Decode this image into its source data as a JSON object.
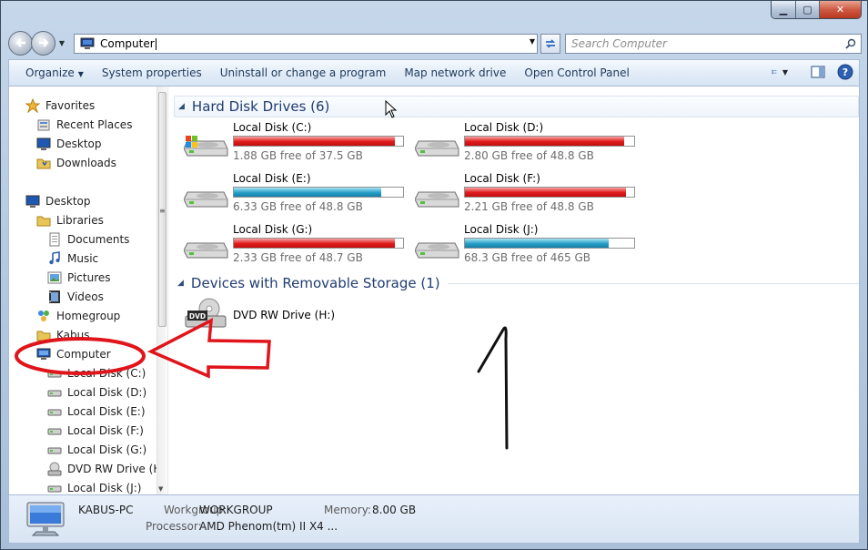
{
  "window": {
    "caption_min": "▁",
    "caption_max": "▢",
    "caption_close": "✕"
  },
  "address": {
    "value": "Computer"
  },
  "search": {
    "placeholder": "Search Computer"
  },
  "toolbar": {
    "organize": "Organize",
    "system_properties": "System properties",
    "uninstall": "Uninstall or change a program",
    "map_network_drive": "Map network drive",
    "open_control_panel": "Open Control Panel"
  },
  "navpane": {
    "items": [
      {
        "label": "Favorites",
        "icon": "star-icon"
      },
      {
        "label": "Recent Places",
        "icon": "recent-places-icon"
      },
      {
        "label": "Desktop",
        "icon": "desktop-icon"
      },
      {
        "label": "Downloads",
        "icon": "folder-icon"
      },
      {
        "label": "Desktop",
        "icon": "desktop-icon"
      },
      {
        "label": "Libraries",
        "icon": "libraries-icon"
      },
      {
        "label": "Documents",
        "icon": "documents-icon"
      },
      {
        "label": "Music",
        "icon": "music-icon"
      },
      {
        "label": "Pictures",
        "icon": "pictures-icon"
      },
      {
        "label": "Videos",
        "icon": "videos-icon"
      },
      {
        "label": "Homegroup",
        "icon": "homegroup-icon"
      },
      {
        "label": "Kabus",
        "icon": "user-folder-icon"
      },
      {
        "label": "Computer",
        "icon": "computer-icon"
      },
      {
        "label": "Local Disk (C:)",
        "icon": "drive-icon"
      },
      {
        "label": "Local Disk (D:)",
        "icon": "drive-icon"
      },
      {
        "label": "Local Disk (E:)",
        "icon": "drive-icon"
      },
      {
        "label": "Local Disk (F:)",
        "icon": "drive-icon"
      },
      {
        "label": "Local Disk (G:)",
        "icon": "drive-icon"
      },
      {
        "label": "DVD RW Drive (H:",
        "icon": "dvd-drive-icon"
      },
      {
        "label": "Local Disk (J:)",
        "icon": "drive-icon"
      }
    ]
  },
  "groups": {
    "hdd": "Hard Disk Drives (6)",
    "removable": "Devices with Removable Storage (1)"
  },
  "drives": [
    {
      "name": "Local Disk (C:)",
      "free": "1.88 GB free of 37.5 GB",
      "used_fraction": 0.95,
      "status": "red",
      "system": true
    },
    {
      "name": "Local Disk (D:)",
      "free": "2.80 GB free of 48.8 GB",
      "used_fraction": 0.94,
      "status": "red",
      "system": false
    },
    {
      "name": "Local Disk (E:)",
      "free": "6.33 GB free of 48.8 GB",
      "used_fraction": 0.87,
      "status": "blue",
      "system": false
    },
    {
      "name": "Local Disk (F:)",
      "free": "2.21 GB free of 48.8 GB",
      "used_fraction": 0.95,
      "status": "red",
      "system": false
    },
    {
      "name": "Local Disk (G:)",
      "free": "2.33 GB free of 48.7 GB",
      "used_fraction": 0.95,
      "status": "red",
      "system": false
    },
    {
      "name": "Local Disk (J:)",
      "free": "68.3 GB free of 465 GB",
      "used_fraction": 0.85,
      "status": "blue",
      "system": false
    }
  ],
  "removable": [
    {
      "name": "DVD RW Drive (H:)",
      "badge": "DVD"
    }
  ],
  "status": {
    "pc_name": "KABUS-PC",
    "workgroup_label": "Workgroup:",
    "workgroup": "WORKGROUP",
    "memory_label": "Memory:",
    "memory": "8.00 GB",
    "processor_label": "Processor:",
    "processor": "AMD Phenom(tm) II X4 ..."
  },
  "colors": {
    "bar_red": "#e01b1b",
    "bar_blue": "#26a0c7",
    "annotation_red": "#e0141b",
    "group_title": "#1f3c72"
  }
}
